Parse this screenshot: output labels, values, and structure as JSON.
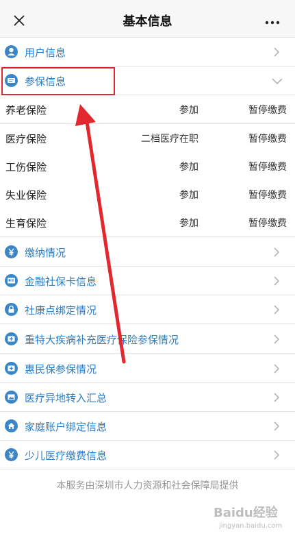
{
  "header": {
    "title": "基本信息",
    "close_icon": "close-icon",
    "more_icon": "more-dots-icon"
  },
  "menu_top": [
    {
      "label": "用户信息",
      "icon": "user-icon"
    },
    {
      "label": "参保信息",
      "icon": "card-icon",
      "expanded": true
    }
  ],
  "insurance_items": [
    {
      "name": "养老保险",
      "status": "参加",
      "payment": "暂停缴费"
    },
    {
      "name": "医疗保险",
      "status": "二档医疗在职",
      "payment": "暂停缴费"
    },
    {
      "name": "工伤保险",
      "status": "参加",
      "payment": "暂停缴费"
    },
    {
      "name": "失业保险",
      "status": "参加",
      "payment": "暂停缴费"
    },
    {
      "name": "生育保险",
      "status": "参加",
      "payment": "暂停缴费"
    }
  ],
  "menu_bottom": [
    {
      "label": "缴纳情况",
      "icon": "yuan-icon"
    },
    {
      "label": "金融社保卡信息",
      "icon": "id-card-icon"
    },
    {
      "label": "社康点绑定情况",
      "icon": "lock-icon"
    },
    {
      "label": "重特大疾病补充医疗保险参保情况",
      "icon": "medical-cross-icon"
    },
    {
      "label": "惠民保参保情况",
      "icon": "medical-cross-icon"
    },
    {
      "label": "医疗异地转入汇总",
      "icon": "image-icon"
    },
    {
      "label": "家庭账户绑定信息",
      "icon": "home-icon"
    },
    {
      "label": "少儿医疗缴费信息",
      "icon": "yuan-icon"
    }
  ],
  "footer": {
    "text": "本服务由深圳市人力资源和社会保障局提供"
  },
  "watermark": {
    "logo": "Baidu经验",
    "url": "jingyan.baidu.com"
  },
  "colors": {
    "accent": "#2b7dc4",
    "annotation": "#e0282e"
  }
}
